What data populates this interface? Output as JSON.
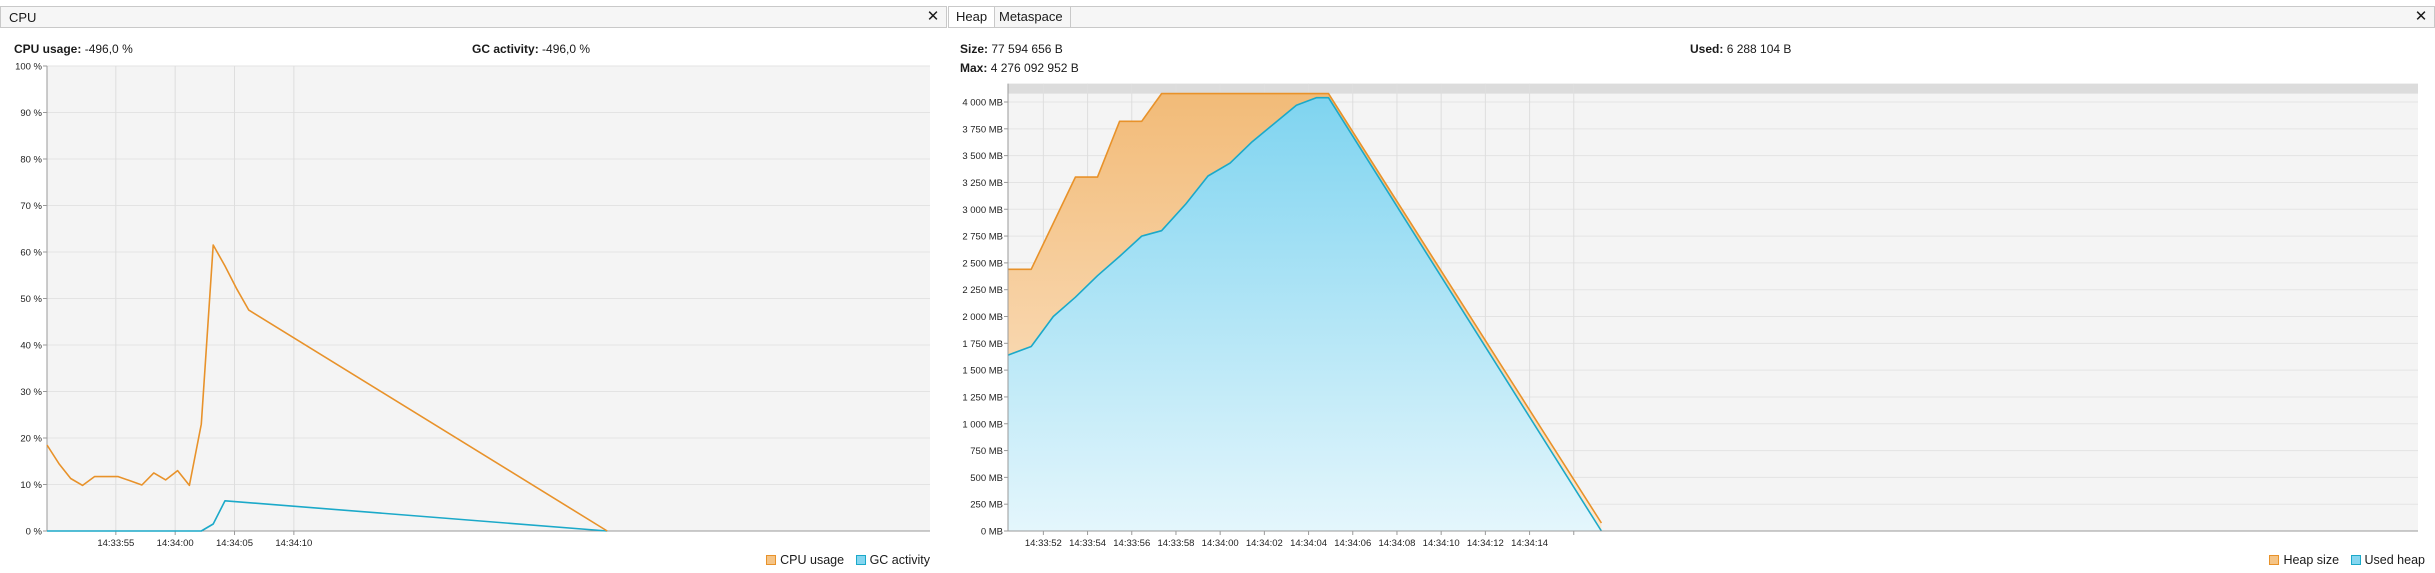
{
  "cpu": {
    "title": "CPU",
    "cpu_usage_label": "CPU usage:",
    "cpu_usage_value": "-496,0 %",
    "gc_activity_label": "GC activity:",
    "gc_activity_value": "-496,0 %"
  },
  "heap": {
    "tabs": [
      {
        "label": "Heap",
        "active": true
      },
      {
        "label": "Metaspace",
        "active": false
      }
    ],
    "size_label": "Size:",
    "size_value": "77 594 656 B",
    "used_label": "Used:",
    "used_value": "6 288 104 B",
    "max_label": "Max:",
    "max_value": "4 276 092 952 B"
  },
  "colors": {
    "orange": "#e8922a",
    "blue": "#1ba9c9",
    "orange_fill": "#f5c486",
    "blue_fill": "#84d6f0"
  },
  "chart_data": [
    {
      "type": "line",
      "ylim": [
        0,
        100
      ],
      "yticks": [
        0,
        10,
        20,
        30,
        40,
        50,
        60,
        70,
        80,
        90,
        100
      ],
      "ytick_labels": [
        "0 %",
        "10 %",
        "20 %",
        "30 %",
        "40 %",
        "50 %",
        "60 %",
        "70 %",
        "80 %",
        "90 %",
        "100 %"
      ],
      "xlim": [
        -60.8,
        13.6
      ],
      "xticks": [
        -55,
        -50,
        -45,
        -40
      ],
      "xtick_labels": [
        "14:33:55",
        "14:34:00",
        "14:34:05",
        "14:34:10"
      ],
      "grid": true,
      "legend_position": "bottom-right",
      "series": [
        {
          "name": "CPU usage",
          "color": "#e8922a",
          "x": [
            -60.8,
            -59.8,
            -58.8,
            -57.8,
            -56.8,
            -55.8,
            -54.8,
            -53.8,
            -52.8,
            -51.8,
            -50.8,
            -49.8,
            -48.8,
            -47.8,
            -46.8,
            -45.8,
            -44.8,
            -43.8,
            -13.6
          ],
          "y": [
            18.5,
            14.5,
            11.3,
            9.8,
            11.7,
            11.7,
            11.7,
            10.8,
            9.9,
            12.5,
            11,
            13,
            9.8,
            23,
            61.5,
            57,
            52,
            47.5,
            0
          ]
        },
        {
          "name": "GC activity",
          "color": "#1ba9c9",
          "x": [
            -60.8,
            -56.8,
            -49.8,
            -47.8,
            -46.8,
            -45.8,
            -13.6
          ],
          "y": [
            0,
            0,
            0,
            0,
            1.5,
            6.5,
            0
          ]
        }
      ]
    },
    {
      "type": "area",
      "ylim": [
        0,
        4000
      ],
      "yticks": [
        0,
        250,
        500,
        750,
        1000,
        1250,
        1500,
        1750,
        2000,
        2250,
        2500,
        2750,
        3000,
        3250,
        3500,
        3750,
        4000
      ],
      "ytick_labels": [
        "0 MB",
        "250 MB",
        "500 MB",
        "750 MB",
        "1 000 MB",
        "1 250 MB",
        "1 500 MB",
        "1 750 MB",
        "2 000 MB",
        "2 250 MB",
        "2 500 MB",
        "2 750 MB",
        "3 000 MB",
        "3 250 MB",
        "3 500 MB",
        "3 750 MB",
        "4 000 MB"
      ],
      "ymax_band": 4078,
      "xlim": [
        -69.6,
        -5.8
      ],
      "xticks": [
        -68,
        -66,
        -64,
        -62,
        -60,
        -58,
        -56,
        -54,
        -52,
        -50,
        -48,
        -46,
        -44
      ],
      "xtick_labels": [
        "14:33:52",
        "14:33:54",
        "14:33:56",
        "14:33:58",
        "14:34:00",
        "14:34:02",
        "14:34:04",
        "14:34:06",
        "14:34:08",
        "14:34:10",
        "14:34:12",
        "14:34:14"
      ],
      "grid": true,
      "legend_position": "bottom-right",
      "series": [
        {
          "name": "Heap size",
          "color": "#e8922a",
          "x": [
            -69.6,
            -68.55,
            -66.55,
            -65.55,
            -64.55,
            -63.55,
            -62.65,
            -55.1,
            -42.75
          ],
          "y": [
            2440,
            2440,
            3300,
            3300,
            3820,
            3820,
            4078,
            4078,
            75
          ]
        },
        {
          "name": "Used heap",
          "color": "#1ba9c9",
          "x": [
            -69.6,
            -68.55,
            -67.55,
            -66.55,
            -65.55,
            -64.55,
            -63.55,
            -62.65,
            -61.55,
            -60.55,
            -59.55,
            -58.55,
            -57.55,
            -56.55,
            -55.65,
            -55.1,
            -42.75
          ],
          "y": [
            1640,
            1720,
            2000,
            2180,
            2380,
            2560,
            2750,
            2800,
            3050,
            3310,
            3430,
            3630,
            3800,
            3970,
            4040,
            4040,
            0
          ]
        }
      ]
    }
  ]
}
